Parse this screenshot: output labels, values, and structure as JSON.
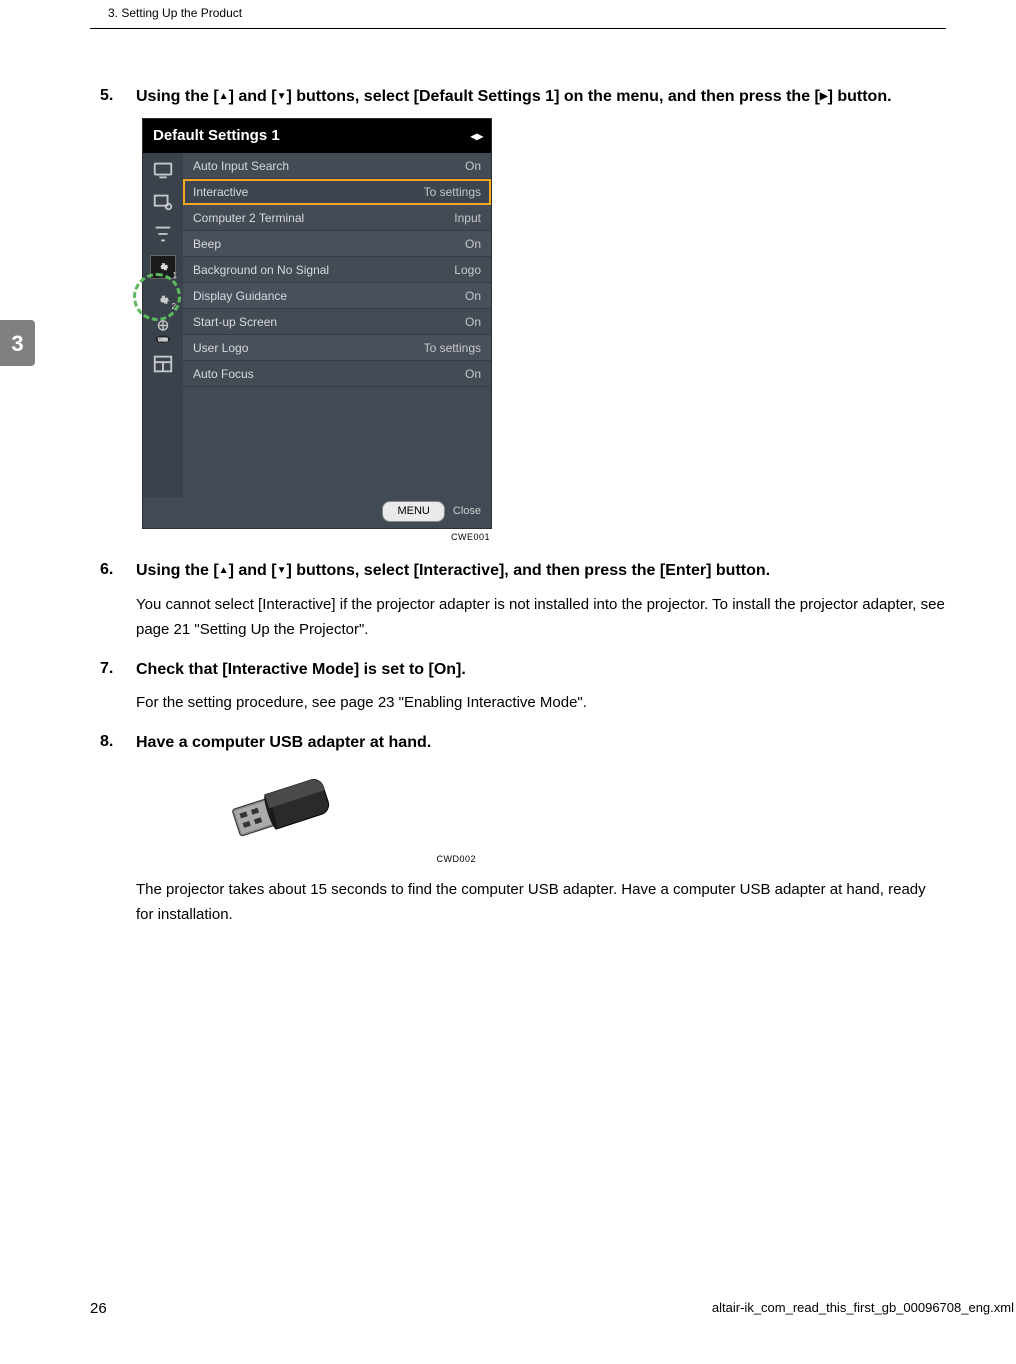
{
  "header": {
    "chapter": "3. Setting Up the Product"
  },
  "sideTab": "3",
  "steps": {
    "s5": {
      "num": "5.",
      "title_parts": {
        "a": "Using the [",
        "b": "] and [",
        "c": "] buttons, select [Default Settings 1] on the menu, and then press the [",
        "d": "] button."
      },
      "figId": "CWE001"
    },
    "s6": {
      "num": "6.",
      "title_parts": {
        "a": "Using the [",
        "b": "] and [",
        "c": "] buttons, select [Interactive], and then press the [Enter] button."
      },
      "body": "You cannot select [Interactive] if the projector adapter is not installed into the projector. To install the projector adapter, see page 21 \"Setting Up the Projector\"."
    },
    "s7": {
      "num": "7.",
      "title": "Check that [Interactive Mode] is set to [On].",
      "body": "For the setting procedure, see page 23 \"Enabling Interactive Mode\"."
    },
    "s8": {
      "num": "8.",
      "title": "Have a computer USB adapter at hand.",
      "figId": "CWD002",
      "body": "The projector takes about 15 seconds to find the computer USB adapter. Have a computer USB adapter at hand, ready for installation."
    }
  },
  "menu": {
    "title": "Default Settings 1",
    "rows": [
      {
        "label": "Auto Input Search",
        "val": "On"
      },
      {
        "label": "Interactive",
        "val": "To settings",
        "sel": true
      },
      {
        "label": "Computer 2 Terminal",
        "val": "Input"
      },
      {
        "label": "Beep",
        "val": "On"
      },
      {
        "label": "Background on No Signal",
        "val": "Logo"
      },
      {
        "label": "Display Guidance",
        "val": "On"
      },
      {
        "label": "Start-up Screen",
        "val": "On"
      },
      {
        "label": "User Logo",
        "val": "To settings"
      },
      {
        "label": "Auto Focus",
        "val": "On"
      }
    ],
    "footer": {
      "menuBtn": "MENU",
      "close": "Close"
    }
  },
  "footer": {
    "page": "26",
    "file": "altair-ik_com_read_this_first_gb_00096708_eng.xml"
  }
}
